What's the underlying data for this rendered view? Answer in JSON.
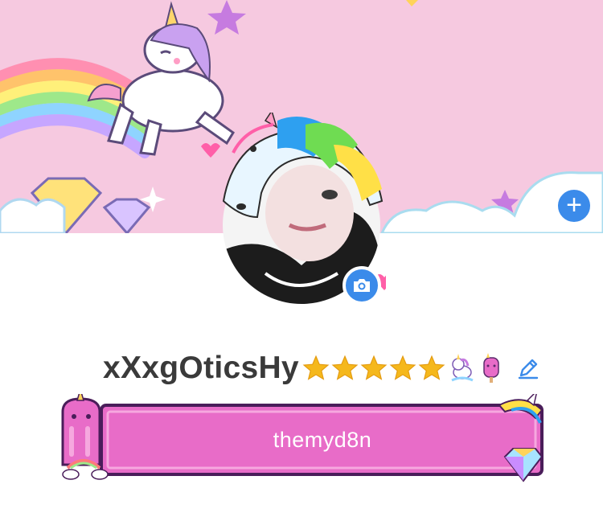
{
  "profile": {
    "username": "xXxgOticsHy",
    "star_count": 5,
    "frame_text": "themyd8n"
  },
  "icons": {
    "add": "plus-icon",
    "camera": "camera-icon",
    "edit": "pencil-icon",
    "stars": "star-icon",
    "stickers": [
      "unicorn-sticker-icon",
      "unicorn-popsicle-sticker-icon"
    ]
  },
  "colors": {
    "accent": "#3b8bea",
    "cover_bg": "#f6c9e0",
    "frame_fill": "#e86cc8",
    "star": "#f5b81c",
    "text": "#3a3a3a"
  }
}
